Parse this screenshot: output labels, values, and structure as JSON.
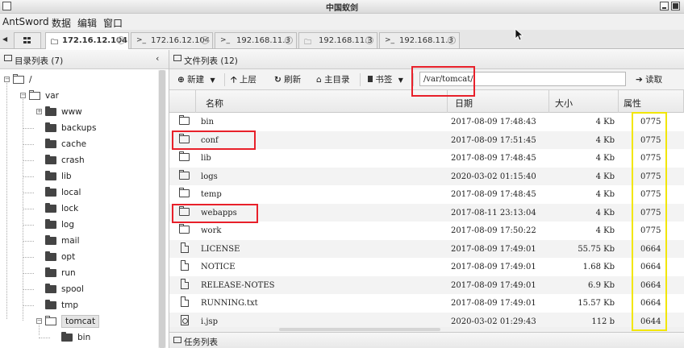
{
  "window": {
    "title": "中国蚁剑"
  },
  "menu": {
    "items": [
      "AntSword",
      "数据",
      "编辑",
      "窗口"
    ]
  },
  "tabs": [
    {
      "label": "172.16.12.104",
      "active": true
    },
    {
      "label": "172.16.12.104",
      "active": false
    },
    {
      "label": "192.168.11.3",
      "active": false
    },
    {
      "label": "192.168.11.3",
      "active": false
    },
    {
      "label": "192.168.11.3",
      "active": false
    }
  ],
  "left_panel": {
    "title": "目录列表 (7)",
    "tree": [
      {
        "label": "/",
        "level": 0,
        "open": true
      },
      {
        "label": "var",
        "level": 1,
        "open": true
      },
      {
        "label": "www",
        "level": 2,
        "expandable": true
      },
      {
        "label": "backups",
        "level": 2
      },
      {
        "label": "cache",
        "level": 2
      },
      {
        "label": "crash",
        "level": 2
      },
      {
        "label": "lib",
        "level": 2
      },
      {
        "label": "local",
        "level": 2
      },
      {
        "label": "lock",
        "level": 2
      },
      {
        "label": "log",
        "level": 2
      },
      {
        "label": "mail",
        "level": 2
      },
      {
        "label": "opt",
        "level": 2
      },
      {
        "label": "run",
        "level": 2
      },
      {
        "label": "spool",
        "level": 2
      },
      {
        "label": "tmp",
        "level": 2
      },
      {
        "label": "tomcat",
        "level": 2,
        "open": true,
        "selected": true
      },
      {
        "label": "bin",
        "level": 3
      }
    ]
  },
  "right_panel": {
    "title": "文件列表 (12)",
    "toolbar": {
      "new": "新建",
      "up": "上层",
      "refresh": "刷新",
      "home": "主目录",
      "bookmark": "书签",
      "path": "/var/tomcat/",
      "read": "读取"
    },
    "columns": [
      "名称",
      "日期",
      "大小",
      "属性"
    ],
    "files": [
      {
        "name": "bin",
        "type": "dir",
        "date": "2017-08-09 17:48:43",
        "size": "4 Kb",
        "perm": "0775"
      },
      {
        "name": "conf",
        "type": "dir",
        "date": "2017-08-09 17:51:45",
        "size": "4 Kb",
        "perm": "0775"
      },
      {
        "name": "lib",
        "type": "dir",
        "date": "2017-08-09 17:48:45",
        "size": "4 Kb",
        "perm": "0775"
      },
      {
        "name": "logs",
        "type": "dir",
        "date": "2020-03-02 01:15:40",
        "size": "4 Kb",
        "perm": "0775"
      },
      {
        "name": "temp",
        "type": "dir",
        "date": "2017-08-09 17:48:45",
        "size": "4 Kb",
        "perm": "0775"
      },
      {
        "name": "webapps",
        "type": "dir",
        "date": "2017-08-11 23:13:04",
        "size": "4 Kb",
        "perm": "0775"
      },
      {
        "name": "work",
        "type": "dir",
        "date": "2017-08-09 17:50:22",
        "size": "4 Kb",
        "perm": "0775"
      },
      {
        "name": "LICENSE",
        "type": "file",
        "date": "2017-08-09 17:49:01",
        "size": "55.75 Kb",
        "perm": "0664"
      },
      {
        "name": "NOTICE",
        "type": "file",
        "date": "2017-08-09 17:49:01",
        "size": "1.68 Kb",
        "perm": "0664"
      },
      {
        "name": "RELEASE-NOTES",
        "type": "file",
        "date": "2017-08-09 17:49:01",
        "size": "6.9 Kb",
        "perm": "0664"
      },
      {
        "name": "RUNNING.txt",
        "type": "file",
        "date": "2017-08-09 17:49:01",
        "size": "15.57 Kb",
        "perm": "0664"
      },
      {
        "name": "i.jsp",
        "type": "jsp",
        "date": "2020-03-02 01:29:43",
        "size": "112 b",
        "perm": "0644"
      }
    ]
  },
  "task_panel": {
    "title": "任务列表"
  },
  "colors": {
    "highlight_red": "#e8202a",
    "highlight_yellow": "#f2e600"
  }
}
